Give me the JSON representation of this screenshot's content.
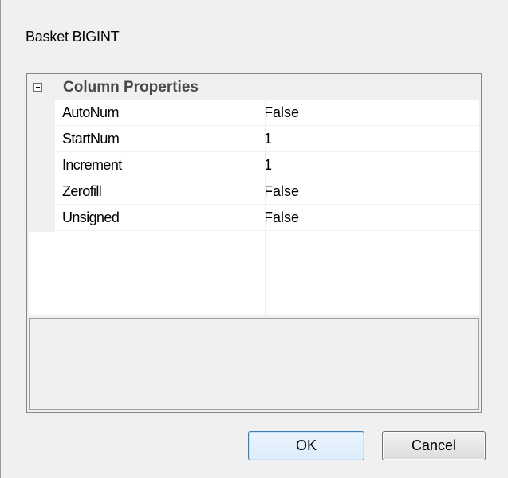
{
  "dialog": {
    "title": "Basket BIGINT"
  },
  "property_grid": {
    "category": "Column Properties",
    "properties": [
      {
        "name": "AutoNum",
        "value": "False"
      },
      {
        "name": "StartNum",
        "value": "1"
      },
      {
        "name": "Increment",
        "value": "1"
      },
      {
        "name": "Zerofill",
        "value": "False"
      },
      {
        "name": "Unsigned",
        "value": "False"
      }
    ]
  },
  "buttons": {
    "ok_label": "OK",
    "cancel_label": "Cancel"
  }
}
